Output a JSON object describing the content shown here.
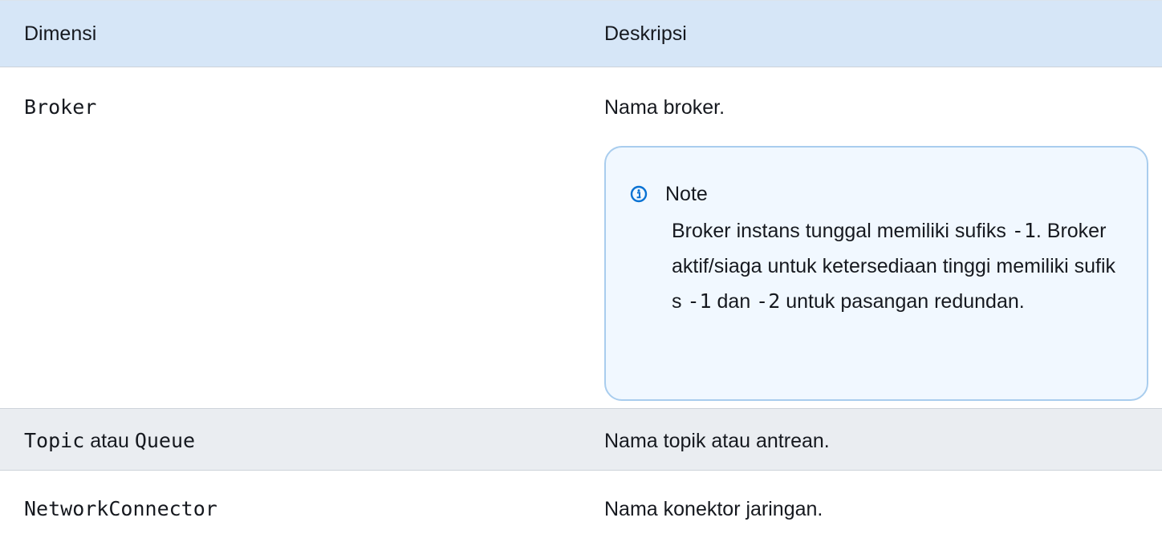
{
  "table": {
    "headers": {
      "dimension": "Dimensi",
      "description": "Deskripsi"
    },
    "rows": {
      "broker": {
        "code": "Broker",
        "description": "Nama broker.",
        "note": {
          "title": "Note",
          "text_1": "Broker instans tunggal memiliki sufiks ",
          "code_1": "-1",
          "text_2": ". Broker aktif/siaga untuk ketersediaan tinggi memiliki sufiks ",
          "code_2": "-1",
          "text_3": " dan ",
          "code_3": "-2",
          "text_4": " untuk pasangan redundan."
        }
      },
      "topic": {
        "code_a": "Topic",
        "joiner": " atau ",
        "code_b": "Queue",
        "description": "Nama topik atau antrean."
      },
      "network": {
        "code": "NetworkConnector",
        "description": "Nama konektor jaringan."
      }
    }
  },
  "colors": {
    "header_bg": "#d6e6f7",
    "stripe_bg": "#eaedf1",
    "note_bg": "#f1f8ff",
    "note_border": "#a9cdee",
    "info_icon": "#0972d3",
    "text": "#16191f"
  },
  "icons": {
    "note": "info-circle-icon"
  }
}
